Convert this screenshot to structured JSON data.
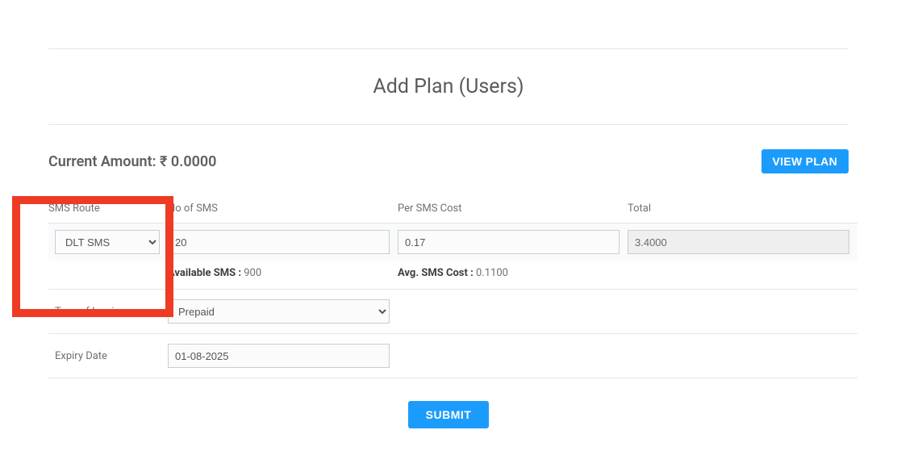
{
  "page_title": "Add Plan (Users)",
  "current_amount_label": "Current Amount:",
  "current_amount_value": "₹ 0.0000",
  "view_plan_label": "VIEW PLAN",
  "cols": {
    "sms_route": "SMS Route",
    "no_of_sms": "No of SMS",
    "per_sms_cost": "Per SMS Cost",
    "total": "Total"
  },
  "inputs": {
    "sms_route_value": "DLT SMS",
    "no_of_sms_value": "20",
    "per_sms_cost_value": "0.17",
    "total_value": "3.4000"
  },
  "stats": {
    "available_sms_label": "Available SMS :",
    "available_sms_value": "900",
    "avg_cost_label": "Avg. SMS Cost :",
    "avg_cost_value": "0.1100"
  },
  "invoice": {
    "label": "Type of Invoice",
    "value": "Prepaid"
  },
  "expiry": {
    "label": "Expiry Date",
    "value": "01-08-2025"
  },
  "submit_label": "SUBMIT"
}
